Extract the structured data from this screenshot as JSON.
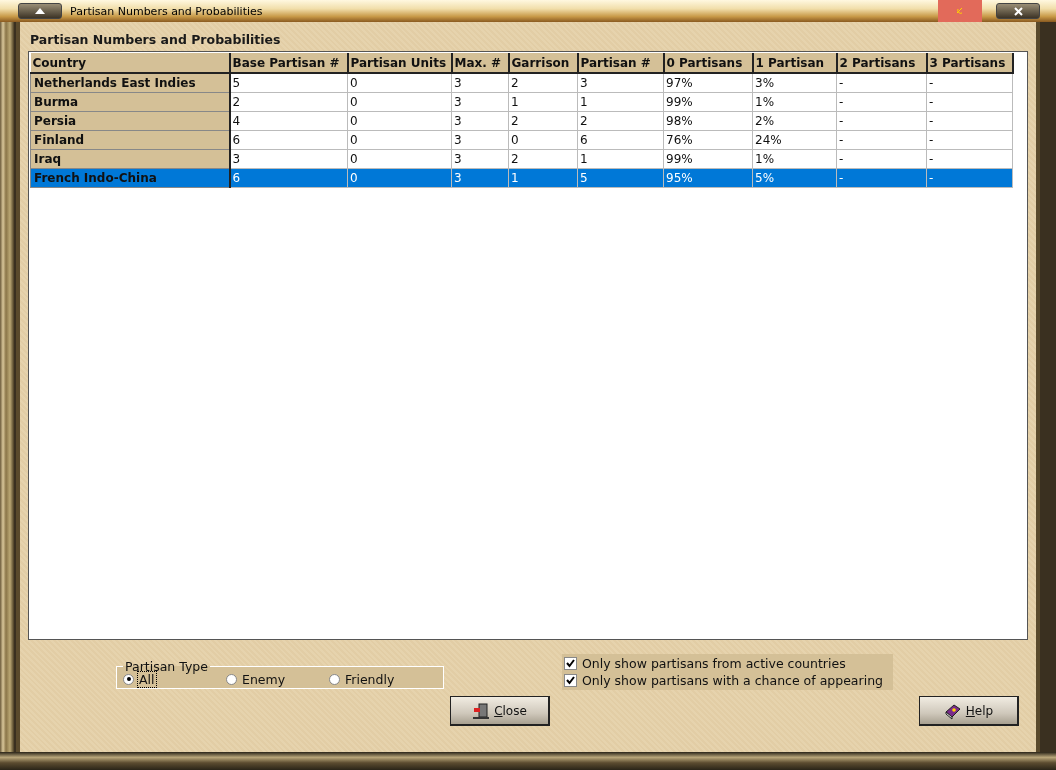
{
  "window": {
    "title": "Partisan Numbers and Probabilities"
  },
  "heading": "Partisan Numbers and Probabilities",
  "table": {
    "columns": [
      "Country",
      "Base Partisan #",
      "Partisan Units",
      "Max. #",
      "Garrison",
      "Partisan #",
      "0 Partisans",
      "1 Partisan",
      "2 Partisans",
      "3 Partisans"
    ],
    "rows": [
      {
        "selected": false,
        "cells": [
          "Netherlands East Indies",
          "5",
          "0",
          "3",
          "2",
          "3",
          "97%",
          "3%",
          "-",
          "-"
        ]
      },
      {
        "selected": false,
        "cells": [
          "Burma",
          "2",
          "0",
          "3",
          "1",
          "1",
          "99%",
          "1%",
          "-",
          "-"
        ]
      },
      {
        "selected": false,
        "cells": [
          "Persia",
          "4",
          "0",
          "3",
          "2",
          "2",
          "98%",
          "2%",
          "-",
          "-"
        ]
      },
      {
        "selected": false,
        "cells": [
          "Finland",
          "6",
          "0",
          "3",
          "0",
          "6",
          "76%",
          "24%",
          "-",
          "-"
        ]
      },
      {
        "selected": false,
        "cells": [
          "Iraq",
          "3",
          "0",
          "3",
          "2",
          "1",
          "99%",
          "1%",
          "-",
          "-"
        ]
      },
      {
        "selected": true,
        "cells": [
          "French Indo-China",
          "6",
          "0",
          "3",
          "1",
          "5",
          "95%",
          "5%",
          "-",
          "-"
        ]
      }
    ]
  },
  "partisan_type": {
    "label": "Partisan Type",
    "options": [
      {
        "label": "All",
        "selected": true
      },
      {
        "label": "Enemy",
        "selected": false
      },
      {
        "label": "Friendly",
        "selected": false
      }
    ]
  },
  "filters": [
    {
      "label": "Only show partisans from active countries",
      "checked": true
    },
    {
      "label": "Only show partisans with a chance of appearing",
      "checked": true
    }
  ],
  "buttons": [
    {
      "kind": "close",
      "label": "Close"
    },
    {
      "kind": "help",
      "label": "Help"
    }
  ]
}
